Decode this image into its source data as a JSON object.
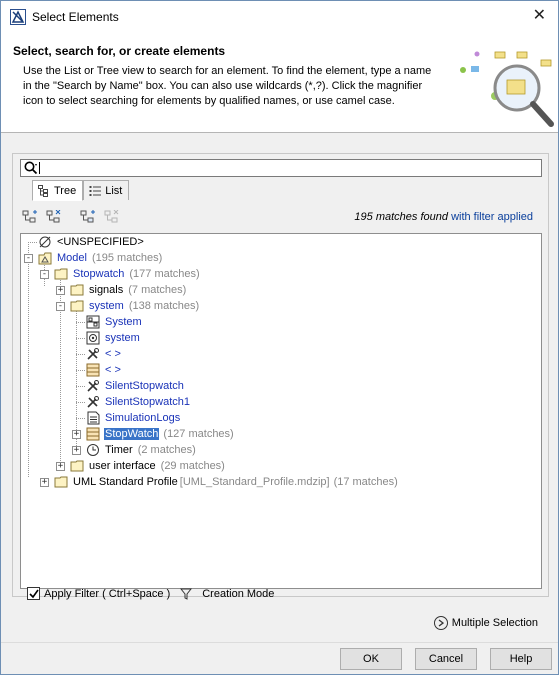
{
  "window": {
    "title": "Select Elements",
    "close_glyph": "✕"
  },
  "header": {
    "title": "Select, search for, or create elements",
    "description": "Use the List or Tree view to search for an element. To find the element, type a name in the \"Search by Name\" box. You can also use wildcards (*,?). Click the magnifier icon to select searching for elements by qualified names, or use camel case."
  },
  "search": {
    "value": "",
    "placeholder": ""
  },
  "tabs": [
    {
      "label": "Tree",
      "active": true
    },
    {
      "label": "List",
      "active": false
    }
  ],
  "toolbar": {
    "icons": [
      "expand-all-icon",
      "collapse-all-icon",
      "expand-selected-icon",
      "collapse-selected-icon"
    ]
  },
  "matches": {
    "count_text": "195 matches found",
    "filter_text": "with filter applied"
  },
  "tree": [
    {
      "label": "<UNSPECIFIED>",
      "extra": "",
      "icon": "unspecified-icon"
    },
    {
      "label": "Model",
      "extra": "(195 matches)",
      "icon": "model-icon"
    },
    {
      "label": "Stopwatch",
      "extra": "(177 matches)",
      "icon": "package-icon"
    },
    {
      "label": "signals",
      "extra": "(7 matches)",
      "icon": "package-icon"
    },
    {
      "label": "system",
      "extra": "(138 matches)",
      "icon": "package-icon"
    },
    {
      "label": "System",
      "extra": "",
      "icon": "block-icon"
    },
    {
      "label": "system",
      "extra": "",
      "icon": "diagram-icon"
    },
    {
      "label": "< >",
      "extra": "",
      "icon": "tool-icon"
    },
    {
      "label": "< >",
      "extra": "",
      "icon": "class-icon"
    },
    {
      "label": "SilentStopwatch",
      "extra": "",
      "icon": "tool-icon"
    },
    {
      "label": "SilentStopwatch1",
      "extra": "",
      "icon": "tool-icon"
    },
    {
      "label": "SimulationLogs",
      "extra": "",
      "icon": "document-icon"
    },
    {
      "label": "StopWatch",
      "extra": "(127 matches)",
      "icon": "class-icon"
    },
    {
      "label": "Timer",
      "extra": "(2 matches)",
      "icon": "timer-icon"
    },
    {
      "label": "user interface",
      "extra": "(29 matches)",
      "icon": "package-icon"
    },
    {
      "label": "UML Standard Profile",
      "path": "[UML_Standard_Profile.mdzip]",
      "extra": "(17 matches)",
      "icon": "package-icon"
    }
  ],
  "filter": {
    "label": "Apply Filter ( Ctrl+Space )",
    "checked": true,
    "creation_mode": "Creation Mode"
  },
  "multiple_selection": {
    "label": "Multiple Selection"
  },
  "buttons": {
    "ok": "OK",
    "cancel": "Cancel",
    "help": "Help"
  },
  "colors": {
    "link_blue": "#1a33b8",
    "selection": "#3a74c8",
    "filter_blue": "#0a3f9c"
  }
}
